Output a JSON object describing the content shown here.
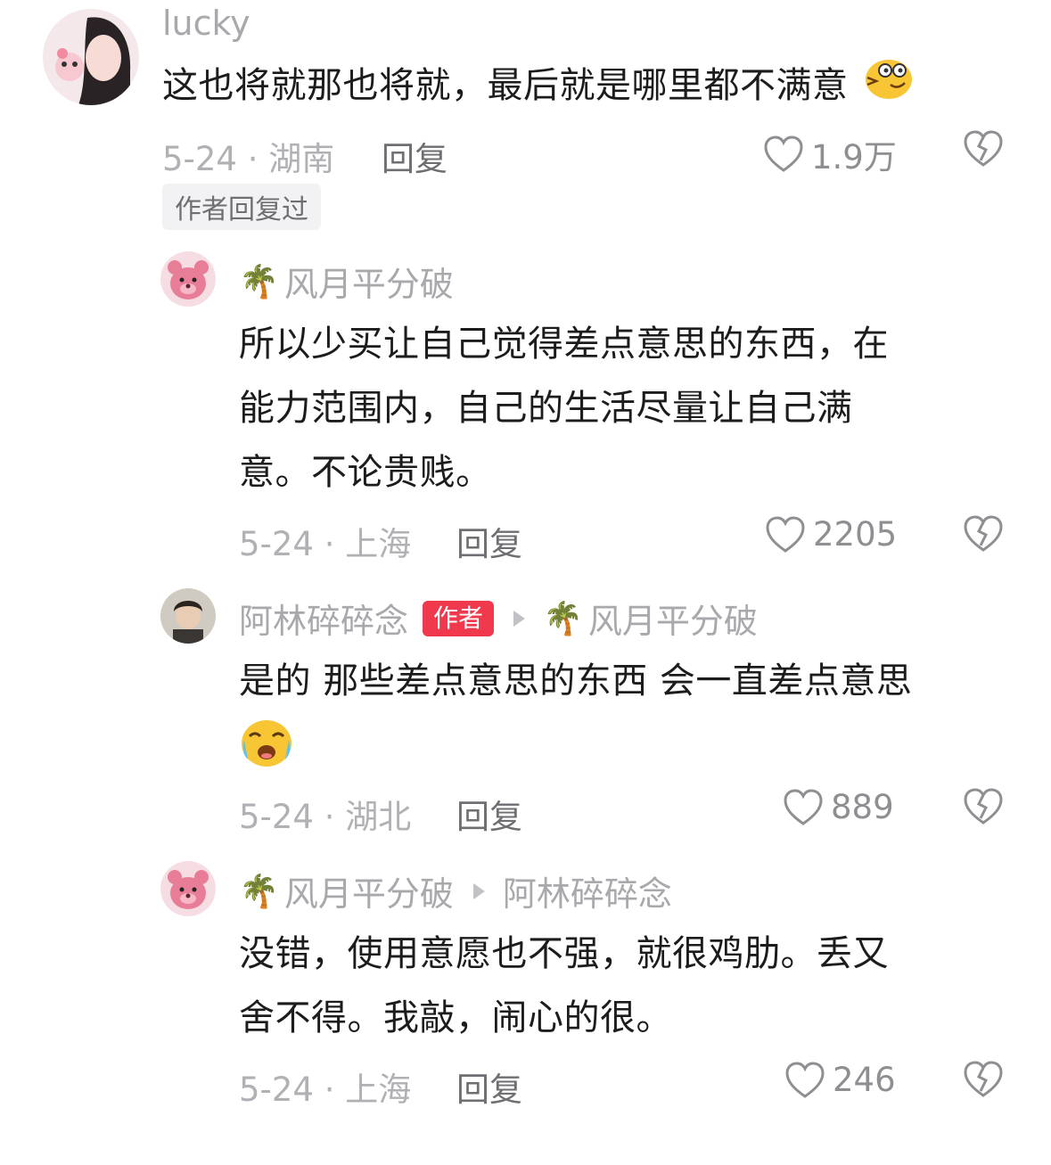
{
  "comments": [
    {
      "username": "lucky",
      "text": "这也将就那也将就，最后就是哪里都不满意",
      "emoji": "thinking-face-icon",
      "date_location": "5-24 · 湖南",
      "reply_label": "回复",
      "likes": "1.9万",
      "author_replied": "作者回复过"
    },
    {
      "username": "风月平分破",
      "text_lines": [
        "所以少买让自己觉得差点意思的东西，在",
        "能力范围内，自己的生活尽量让自己满",
        "意。不论贵贱。"
      ],
      "date_location": "5-24 · 上海",
      "reply_label": "回复",
      "likes": "2205"
    },
    {
      "username": "阿林碎碎念",
      "badge": "作者",
      "reply_to": "风月平分破",
      "text": "是的 那些差点意思的东西 会一直差点意思",
      "emoji": "crying-face-icon",
      "date_location": "5-24 · 湖北",
      "reply_label": "回复",
      "likes": "889"
    },
    {
      "username": "风月平分破",
      "reply_to": "阿林碎碎念",
      "text_lines": [
        "没错，使用意愿也不强，就很鸡肋。丢又",
        "舍不得。我敲，闹心的很。"
      ],
      "date_location": "5-24 · 上海",
      "reply_label": "回复",
      "likes": "246"
    }
  ],
  "colors": {
    "accent_badge": "#f1394d",
    "muted": "#a8a8ad"
  }
}
